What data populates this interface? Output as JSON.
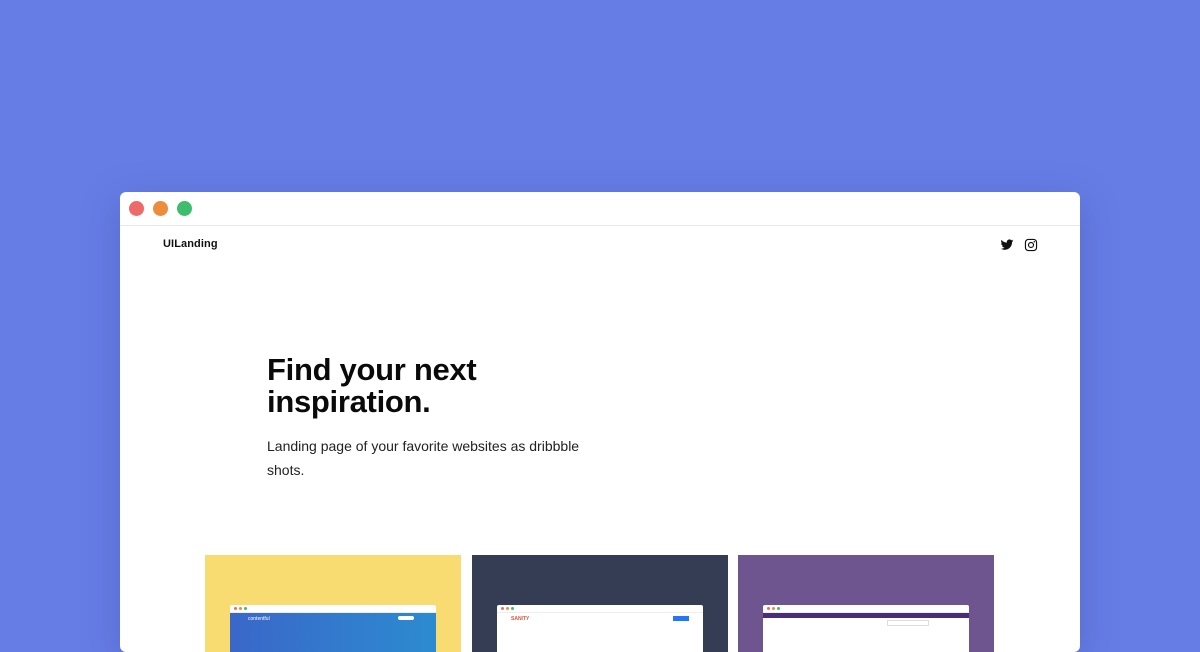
{
  "brand": "UILanding",
  "social": [
    "twitter-icon",
    "instagram-icon"
  ],
  "hero": {
    "title_line1": "Find your next",
    "title_line2": "inspiration.",
    "subtitle_line1": "Landing page of your favorite websites as dribbble",
    "subtitle_line2": "shots."
  },
  "cards": [
    {
      "color": "#f8dc72",
      "logo": "contentful"
    },
    {
      "color": "#353d54",
      "logo": "SANITY"
    },
    {
      "color": "#6f5590",
      "logo": ""
    }
  ],
  "colors": {
    "background": "#667de6",
    "window": "#ffffff"
  }
}
